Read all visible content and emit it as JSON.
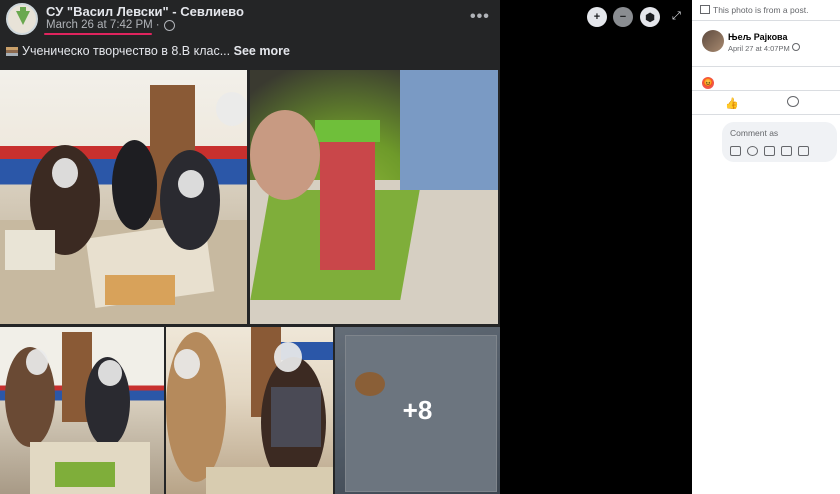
{
  "post": {
    "page_name": "СУ \"Васил Левски\" - Севлиево",
    "timestamp": "March 26 at 7:42 PM",
    "separator": "·",
    "caption": "Ученическо творчество в 8.В клас...",
    "see_more": "See more",
    "more_count": "+8",
    "more_options": "•••"
  },
  "viewer": {
    "zoom_in": "+",
    "zoom_out": "−",
    "tag": "⬢",
    "expand": "⤢"
  },
  "sidebar": {
    "notice": "This photo is from a post.",
    "commenter_name": "Њељ Рајкова",
    "commenter_date": "April 27 at 4:07PM",
    "reaction_emoji": "😡",
    "like_icon": "👍",
    "comment_placeholder": "Comment as"
  },
  "colors": {
    "post_bg": "#242526",
    "text": "#e4e6eb",
    "meta": "#b0b3b8",
    "underline": "#e0245e"
  }
}
